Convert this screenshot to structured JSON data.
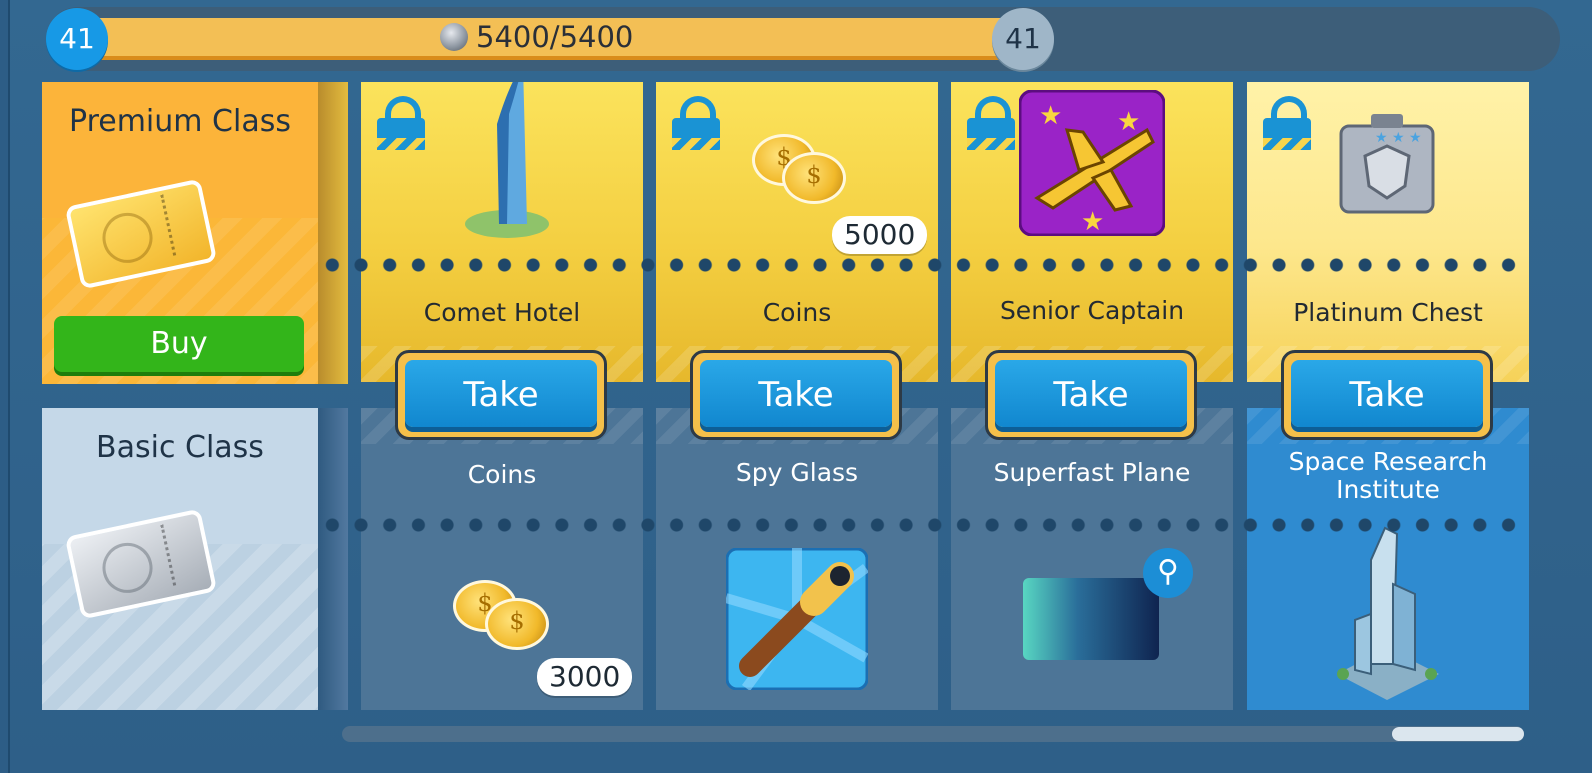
{
  "progress": {
    "level_current": "41",
    "level_next": "41",
    "points_text": "5400/5400",
    "progress_fraction": 1.0,
    "currency_icon": "silver-gem-icon"
  },
  "classes": {
    "premium": {
      "title": "Premium Class",
      "buy_label": "Buy",
      "ticket_icon": "gold-ticket-icon"
    },
    "basic": {
      "title": "Basic Class",
      "ticket_icon": "silver-ticket-icon"
    }
  },
  "columns": [
    {
      "premium_reward": {
        "title": "Comet Hotel",
        "icon": "tower-building-icon",
        "locked": true
      },
      "take_label": "Take",
      "basic_reward": {
        "title": "Coins",
        "icon": "coins-icon",
        "quantity": "3000"
      }
    },
    {
      "premium_reward": {
        "title": "Coins",
        "icon": "coins-icon",
        "quantity": "5000",
        "locked": true
      },
      "take_label": "Take",
      "basic_reward": {
        "title": "Spy Glass",
        "icon": "spyglass-icon"
      }
    },
    {
      "premium_reward": {
        "title": "Senior Captain",
        "icon": "airplane-stars-icon",
        "locked": true
      },
      "take_label": "Take",
      "basic_reward": {
        "title": "Superfast Plane",
        "icon": "speed-trail-icon"
      }
    },
    {
      "premium_reward": {
        "title": "Platinum Chest",
        "icon": "platinum-chest-icon",
        "locked": true
      },
      "take_label": "Take",
      "basic_reward": {
        "title": "Space Research Institute",
        "icon": "research-tower-icon"
      }
    }
  ],
  "colors": {
    "gold_lane": "#f4cf41",
    "blue_lane": "#4d7597",
    "take_button": "#1187cf",
    "buy_button": "#33b51a"
  }
}
